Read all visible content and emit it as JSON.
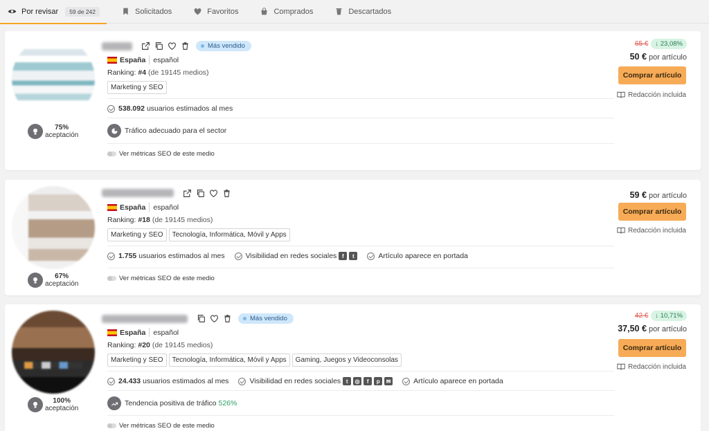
{
  "tabs": [
    {
      "label": "Por revisar",
      "badge": "59 de 242",
      "icon": "eye-icon"
    },
    {
      "label": "Solicitados",
      "icon": "bookmark-icon"
    },
    {
      "label": "Favoritos",
      "icon": "heart-icon"
    },
    {
      "label": "Comprados",
      "icon": "bag-icon"
    },
    {
      "label": "Descartados",
      "icon": "trash-icon"
    }
  ],
  "colors": {
    "accent": "#f5a623",
    "buy_button": "#f7ab57",
    "best_seller_bg": "#cfe7fb",
    "discount_bg": "#d7f3e3",
    "old_price": "#e05a4f",
    "positive": "#2b9e63"
  },
  "common": {
    "buy_label": "Comprar artículo",
    "redaction_label": "Redacción incluida",
    "seo_toggle_label": "Ver métricas SEO de este medio",
    "acceptance_label": "aceptación",
    "country": "España",
    "language": "español",
    "ranking_label": "Ranking:",
    "per_article": "por artículo",
    "users_suffix": "usuarios estimados al mes",
    "best_seller": "Más vendido"
  },
  "listings": [
    {
      "acceptance": "75%",
      "ranking": "#4",
      "ranking_total": "(de 19145 medios)",
      "tags": [
        "Marketing y SEO"
      ],
      "users": "538.092",
      "feature": "Tráfico adecuado para el sector",
      "old_price": "65 €",
      "discount": "↓ 23,08%",
      "price": "50 €"
    },
    {
      "acceptance": "67%",
      "ranking": "#18",
      "ranking_total": "(de 19145 medios)",
      "tags": [
        "Marketing y SEO",
        "Tecnología, Informática, Móvil y Apps"
      ],
      "users": "1.755",
      "social": "Visibilidad en redes sociales",
      "frontpage": "Artículo aparece en portada",
      "price": "59 €"
    },
    {
      "acceptance": "100%",
      "ranking": "#20",
      "ranking_total": "(de 19145 medios)",
      "tags": [
        "Marketing y SEO",
        "Tecnología, Informática, Móvil y Apps",
        "Gaming, Juegos y Videoconsolas"
      ],
      "users": "24.433",
      "social": "Visibilidad en redes sociales",
      "frontpage": "Artículo aparece en portada",
      "feature": "Tendencia positiva de tráfico",
      "feature_value": "526%",
      "old_price": "42 €",
      "discount": "↓ 10,71%",
      "price": "37,50 €"
    }
  ]
}
